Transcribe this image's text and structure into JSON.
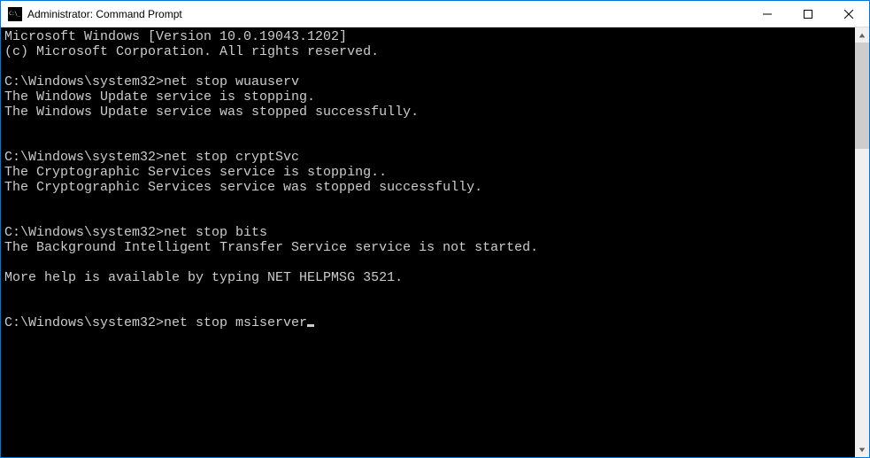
{
  "window": {
    "title": "Administrator: Command Prompt"
  },
  "terminal": {
    "header1": "Microsoft Windows [Version 10.0.19043.1202]",
    "header2": "(c) Microsoft Corporation. All rights reserved.",
    "prompt": "C:\\Windows\\system32>",
    "block1": {
      "cmd": "net stop wuauserv",
      "out1": "The Windows Update service is stopping.",
      "out2": "The Windows Update service was stopped successfully."
    },
    "block2": {
      "cmd": "net stop cryptSvc",
      "out1": "The Cryptographic Services service is stopping..",
      "out2": "The Cryptographic Services service was stopped successfully."
    },
    "block3": {
      "cmd": "net stop bits",
      "out1": "The Background Intelligent Transfer Service service is not started.",
      "out2": "More help is available by typing NET HELPMSG 3521."
    },
    "block4": {
      "cmd": "net stop msiserver"
    }
  }
}
